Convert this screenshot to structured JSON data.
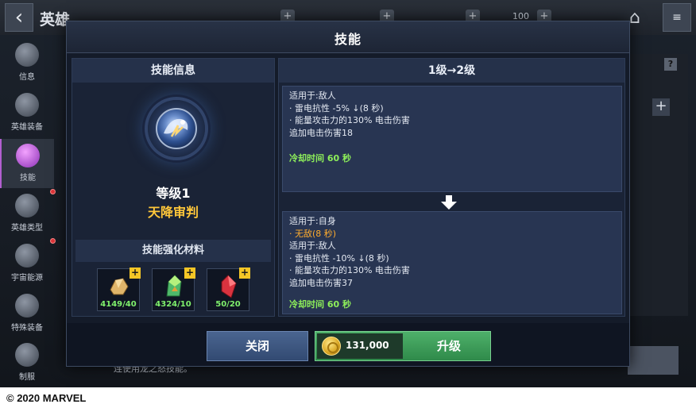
{
  "app": {
    "back_icon": "chevron-left-icon",
    "title": "英雄",
    "topbar": {
      "currency_1": "100",
      "home_icon": "home-icon",
      "menu_icon": "menu-icon"
    },
    "sidebar": {
      "items": [
        {
          "label": "信息",
          "icon": "iron-man-helmet-icon",
          "active": false,
          "badge": false
        },
        {
          "label": "英雄装备",
          "icon": "hammer-icon",
          "active": false,
          "badge": true
        },
        {
          "label": "技能",
          "icon": "fist-icon",
          "active": true,
          "badge": true
        },
        {
          "label": "英雄类型",
          "icon": "spinner-icon",
          "active": false,
          "badge": true
        },
        {
          "label": "宇宙能源",
          "icon": "crystal-icon",
          "active": false,
          "badge": true
        },
        {
          "label": "特殊装备",
          "icon": "figure-icon",
          "active": false,
          "badge": false
        },
        {
          "label": "制服",
          "icon": "mask-icon",
          "active": false,
          "badge": false
        }
      ]
    },
    "background_text": "连使用龙之怒技能。"
  },
  "modal": {
    "title": "技能",
    "info_panel": {
      "header": "技能信息",
      "level": "等级1",
      "skill_name": "天降审判",
      "materials_header": "技能强化材料",
      "materials": [
        {
          "count": "4149/40",
          "color": "#d9a55a"
        },
        {
          "count": "4324/10",
          "color": "#4fb86a"
        },
        {
          "count": "50/20",
          "color": "#d9333f"
        }
      ]
    },
    "upgrade_panel": {
      "header": "1级→2级",
      "current": {
        "lines": [
          {
            "text": "适用于:敌人",
            "highlight": false
          },
          {
            "text": "· 雷电抗性 -5% ↓(8 秒)",
            "highlight": false
          },
          {
            "text": "· 能量攻击力的130% 电击伤害",
            "highlight": false
          },
          {
            "text": "追加电击伤害18",
            "highlight": false
          }
        ],
        "cooldown": "冷却时间 60 秒"
      },
      "next": {
        "lines": [
          {
            "text": "适用于:自身",
            "highlight": false
          },
          {
            "text": "· 无敌(8 秒)",
            "highlight": true
          },
          {
            "text": "适用于:敌人",
            "highlight": false
          },
          {
            "text": "· 雷电抗性 -10% ↓(8 秒)",
            "highlight": false
          },
          {
            "text": "· 能量攻击力的130% 电击伤害",
            "highlight": false
          },
          {
            "text": "追加电击伤害37",
            "highlight": false
          }
        ],
        "cooldown": "冷却时间 60 秒"
      }
    },
    "footer": {
      "close_label": "关闭",
      "cost": "131,000",
      "upgrade_label": "升级"
    }
  },
  "copyright": "© 2020 MARVEL"
}
